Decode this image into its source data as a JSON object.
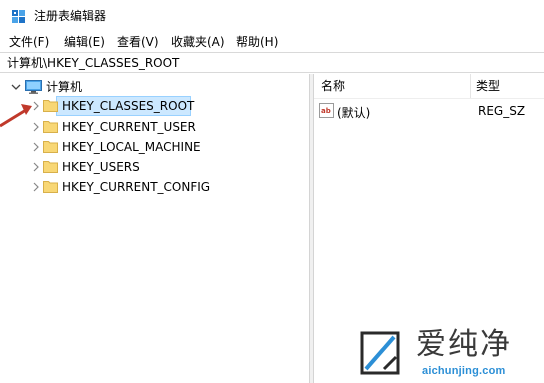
{
  "window": {
    "title": "注册表编辑器"
  },
  "menu": [
    "文件(F)",
    "编辑(E)",
    "查看(V)",
    "收藏夹(A)",
    "帮助(H)"
  ],
  "address": {
    "path": "计算机\\HKEY_CLASSES_ROOT"
  },
  "tree": {
    "root": "计算机",
    "items": [
      {
        "label": "HKEY_CLASSES_ROOT",
        "selected": true
      },
      {
        "label": "HKEY_CURRENT_USER",
        "selected": false
      },
      {
        "label": "HKEY_LOCAL_MACHINE",
        "selected": false
      },
      {
        "label": "HKEY_USERS",
        "selected": false
      },
      {
        "label": "HKEY_CURRENT_CONFIG",
        "selected": false
      }
    ]
  },
  "list": {
    "columns": [
      "名称",
      "类型"
    ],
    "rows": [
      {
        "icon": "ab",
        "name": "(默认)",
        "type": "REG_SZ"
      }
    ]
  },
  "watermark": {
    "cn": "爱纯净",
    "en": "aichunjing.com"
  },
  "colors": {
    "selection": "#cce8ff",
    "selection_border": "#99d1ff",
    "folder": "#f8d775",
    "arrow": "#c0392b",
    "watermark_blue": "#2c8fd6"
  }
}
